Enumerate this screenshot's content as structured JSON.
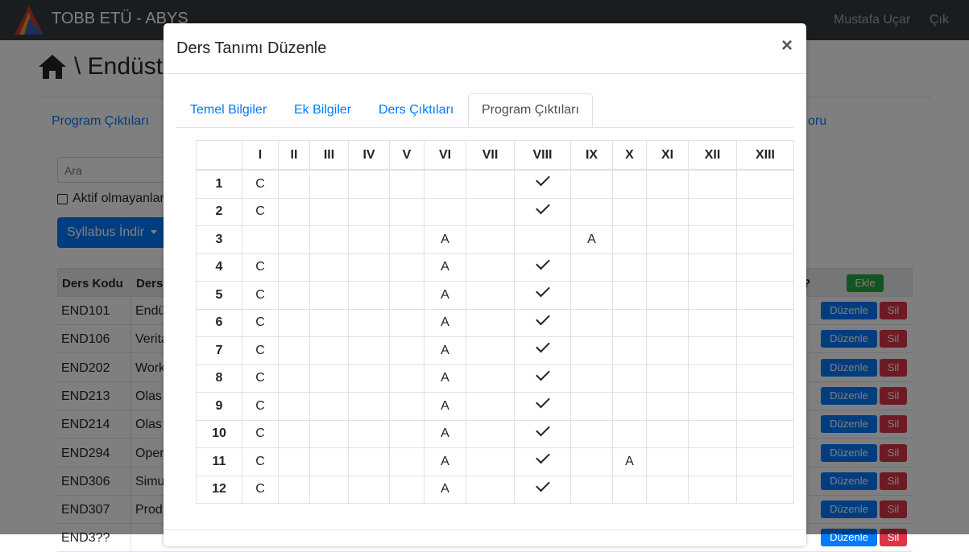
{
  "app": {
    "brand": "TOBB ETÜ - ABYS",
    "user": "Mustafa Uçar",
    "logout": "Çık"
  },
  "page": {
    "title": "\\ Endüst",
    "tab_left": "Program Çıktıları",
    "tab_right": "oru",
    "search_placeholder": "Ara",
    "inactive_label": "Aktif olmayanlar",
    "syllabus_button": "Syllabus İndir",
    "table": {
      "col_code": "Ders Kodu",
      "col_name": "Ders",
      "col_q": "?",
      "add_label": "Ekle",
      "edit_label": "Düzenle",
      "delete_label": "Sil",
      "rows": [
        {
          "code": "END101",
          "name": "Endü"
        },
        {
          "code": "END106",
          "name": "Verita"
        },
        {
          "code": "END202",
          "name": "Work"
        },
        {
          "code": "END213",
          "name": "Olas"
        },
        {
          "code": "END214",
          "name": "Olas"
        },
        {
          "code": "END294",
          "name": "Oper"
        },
        {
          "code": "END306",
          "name": "Simu"
        },
        {
          "code": "END307",
          "name": "Prod"
        },
        {
          "code": "END3??",
          "name": ""
        }
      ]
    }
  },
  "modal": {
    "title": "Ders Tanımı Düzenle",
    "close_symbol": "×",
    "tabs": [
      "Temel Bilgiler",
      "Ek Bilgiler",
      "Ders Çıktıları",
      "Program Çıktıları"
    ],
    "active_tab": "Program Çıktıları",
    "columns": [
      "",
      "I",
      "II",
      "III",
      "IV",
      "V",
      "VI",
      "VII",
      "VIII",
      "IX",
      "X",
      "XI",
      "XII",
      "XIII"
    ],
    "rows": [
      [
        "1",
        "C",
        "",
        "",
        "",
        "",
        "",
        "",
        "check",
        "",
        "",
        "",
        "",
        ""
      ],
      [
        "2",
        "C",
        "",
        "",
        "",
        "",
        "",
        "",
        "check",
        "",
        "",
        "",
        "",
        ""
      ],
      [
        "3",
        "",
        "",
        "",
        "",
        "",
        "A",
        "",
        "",
        "A",
        "",
        "",
        "",
        ""
      ],
      [
        "4",
        "C",
        "",
        "",
        "",
        "",
        "A",
        "",
        "check",
        "",
        "",
        "",
        "",
        ""
      ],
      [
        "5",
        "C",
        "",
        "",
        "",
        "",
        "A",
        "",
        "check",
        "",
        "",
        "",
        "",
        ""
      ],
      [
        "6",
        "C",
        "",
        "",
        "",
        "",
        "A",
        "",
        "check",
        "",
        "",
        "",
        "",
        ""
      ],
      [
        "7",
        "C",
        "",
        "",
        "",
        "",
        "A",
        "",
        "check",
        "",
        "",
        "",
        "",
        ""
      ],
      [
        "8",
        "C",
        "",
        "",
        "",
        "",
        "A",
        "",
        "check",
        "",
        "",
        "",
        "",
        ""
      ],
      [
        "9",
        "C",
        "",
        "",
        "",
        "",
        "A",
        "",
        "check",
        "",
        "",
        "",
        "",
        ""
      ],
      [
        "10",
        "C",
        "",
        "",
        "",
        "",
        "A",
        "",
        "check",
        "",
        "",
        "",
        "",
        ""
      ],
      [
        "11",
        "C",
        "",
        "",
        "",
        "",
        "A",
        "",
        "check",
        "",
        "A",
        "",
        "",
        ""
      ],
      [
        "12",
        "C",
        "",
        "",
        "",
        "",
        "A",
        "",
        "check",
        "",
        "",
        "",
        "",
        ""
      ]
    ]
  }
}
